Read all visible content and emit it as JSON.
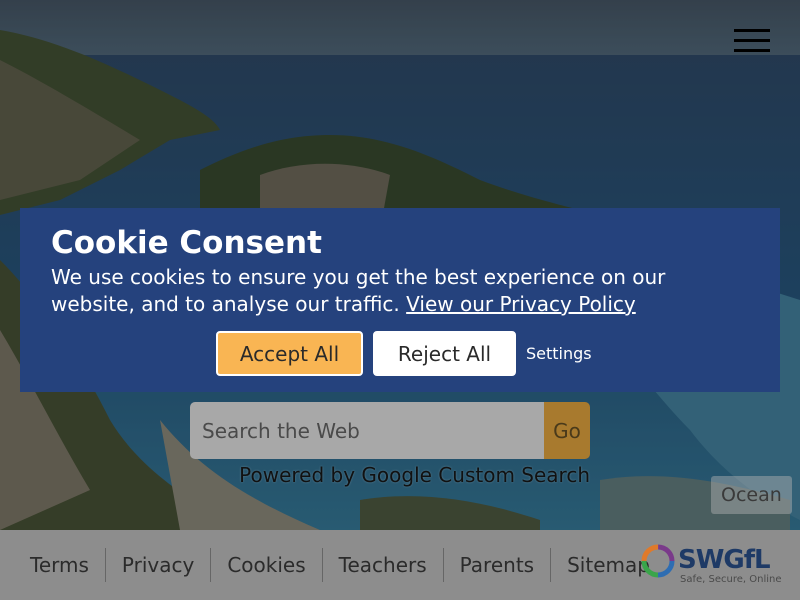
{
  "cookie": {
    "title": "Cookie Consent",
    "message": "We use cookies to ensure you get the best experience on our website, and to analyse our traffic.",
    "policy_link": "View our Privacy Policy",
    "accept_label": "Accept All",
    "reject_label": "Reject All",
    "settings_label": "Settings"
  },
  "search": {
    "placeholder": "Search the Web",
    "go_label": "Go",
    "powered_by": "Powered by Google Custom Search"
  },
  "background": {
    "label": "Ocean"
  },
  "footer": {
    "links": [
      "Terms",
      "Privacy",
      "Cookies",
      "Teachers",
      "Parents",
      "Sitemap"
    ],
    "logo_name": "SWGfL",
    "logo_tagline": "Safe, Secure, Online"
  },
  "colors": {
    "banner": "#25427d",
    "accept": "#f9b553",
    "footer": "#8d8d8d"
  }
}
